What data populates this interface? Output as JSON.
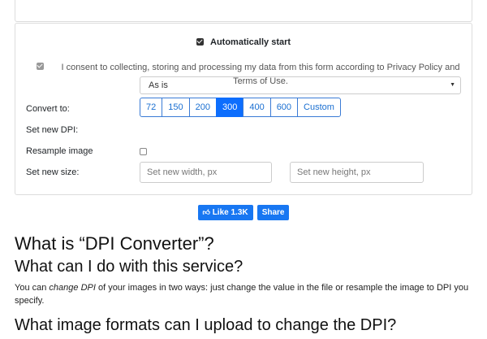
{
  "options": {
    "auto_start_label": "Automatically start",
    "consent_text": "I consent to collecting, storing and processing my data from this form according to Privacy Policy and Terms of Use.",
    "convert_to_label": "Convert to:",
    "convert_to_value": "As is",
    "set_dpi_label": "Set new DPI:",
    "dpi_options": [
      "72",
      "150",
      "200",
      "300",
      "400",
      "600",
      "Custom"
    ],
    "dpi_selected": "300",
    "resample_label": "Resample image",
    "set_size_label": "Set new size:",
    "width_placeholder": "Set new width, px",
    "height_placeholder": "Set new height, px"
  },
  "social": {
    "like_label": "Like 1.3K",
    "share_label": "Share"
  },
  "article": {
    "h_main": "What is “DPI Converter”?",
    "h_service": "What can I do with this service?",
    "p_pre": "You can ",
    "p_em": "change DPI",
    "p_post": " of your images in two ways: just change the value in the file or resample the image to DPI you specify.",
    "h_formats": "What image formats can I upload to change the DPI?"
  }
}
